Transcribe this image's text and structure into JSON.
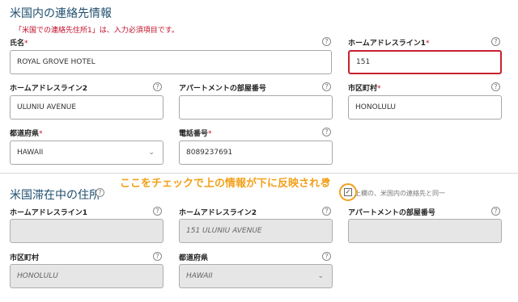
{
  "us_contact": {
    "title": "米国内の連絡先情報",
    "required_note": "「米国での連絡先住所1」は、入力必須項目です。",
    "name": {
      "label": "氏名",
      "value": "ROYAL GROVE HOTEL"
    },
    "home_address1": {
      "label": "ホームアドレスライン1",
      "value": "151"
    },
    "home_address2": {
      "label": "ホームアドレスライン2",
      "value": "ULUNIU AVENUE"
    },
    "apartment": {
      "label": "アパートメントの部屋番号",
      "value": ""
    },
    "city": {
      "label": "市区町村",
      "value": "HONOLULU"
    },
    "state": {
      "label": "都道府県",
      "value": "HAWAII"
    },
    "phone": {
      "label": "電話番号",
      "value": "8089237691"
    }
  },
  "stay_address": {
    "title": "米国滞在中の住所",
    "annotation": "ここをチェックで上の情報が下に反映される",
    "checkbox_label": "上欄の、米国内の連絡先と同一",
    "checkbox_checked": true,
    "home_address1": {
      "label": "ホームアドレスライン1",
      "value": ""
    },
    "home_address2": {
      "label": "ホームアドレスライン2",
      "value": "151 ULUNIU AVENUE"
    },
    "apartment": {
      "label": "アパートメントの部屋番号",
      "value": ""
    },
    "city": {
      "label": "市区町村",
      "value": "HONOLULU"
    },
    "state": {
      "label": "都道府県",
      "value": "HAWAII"
    }
  },
  "ui": {
    "required_mark": "*",
    "help_glyph": "?",
    "chevron_glyph": "⌄",
    "check_glyph": "✓",
    "arrow_glyph": "➜"
  },
  "colors": {
    "required": "#c0102a",
    "title": "#1f4e6d",
    "annotation": "#f2a01a",
    "error_border": "#c8202f",
    "disabled_bg": "#e6e6e6"
  }
}
